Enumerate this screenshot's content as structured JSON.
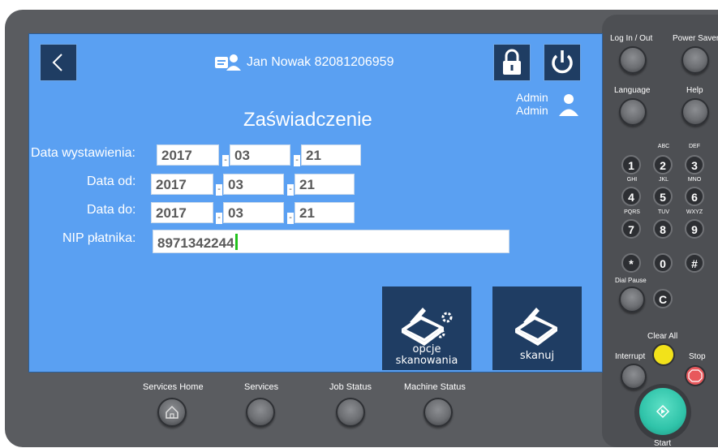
{
  "header": {
    "user_name": "Jan Nowak 82081206959",
    "admin_line1": "Admin",
    "admin_line2": "Admin"
  },
  "title": "Zaświadczenie",
  "form": {
    "issue_date": {
      "label": "Data wystawienia:",
      "year": "2017",
      "month": "03",
      "day": "21"
    },
    "date_from": {
      "label": "Data od:",
      "year": "2017",
      "month": "03",
      "day": "21"
    },
    "date_to": {
      "label": "Data do:",
      "year": "2017",
      "month": "03",
      "day": "21"
    },
    "nip": {
      "label": "NIP płatnika:",
      "value": "8971342244"
    },
    "separator": "-"
  },
  "tiles": {
    "scan_options_line1": "opcje",
    "scan_options_line2": "skanowania",
    "scan": "skanuj"
  },
  "bottom_bar": {
    "services_home": "Services Home",
    "services": "Services",
    "job_status": "Job Status",
    "machine_status": "Machine Status"
  },
  "side_panel": {
    "log_in_out": "Log In / Out",
    "power_saver": "Power Saver",
    "language": "Language",
    "help": "Help",
    "dial_pause": "Dial Pause",
    "clear_all": "Clear All",
    "interrupt": "Interrupt",
    "stop": "Stop",
    "start": "Start",
    "keys": [
      {
        "digit": "1",
        "letters": ""
      },
      {
        "digit": "2",
        "letters": "ABC"
      },
      {
        "digit": "3",
        "letters": "DEF"
      },
      {
        "digit": "4",
        "letters": "GHI"
      },
      {
        "digit": "5",
        "letters": "JKL"
      },
      {
        "digit": "6",
        "letters": "MNO"
      },
      {
        "digit": "7",
        "letters": "PQRS"
      },
      {
        "digit": "8",
        "letters": "TUV"
      },
      {
        "digit": "9",
        "letters": "WXYZ"
      },
      {
        "digit": "*",
        "letters": ""
      },
      {
        "digit": "0",
        "letters": ""
      },
      {
        "digit": "#",
        "letters": ""
      },
      {
        "digit": "C",
        "letters": ""
      }
    ]
  },
  "colors": {
    "screen_bg": "#5aa0f2",
    "tile_bg": "#1f3d63",
    "caret": "#21c21d",
    "start_button": "#2fc3a9",
    "clear_all_button": "#f2e21a",
    "stop_button": "#e8585c"
  }
}
